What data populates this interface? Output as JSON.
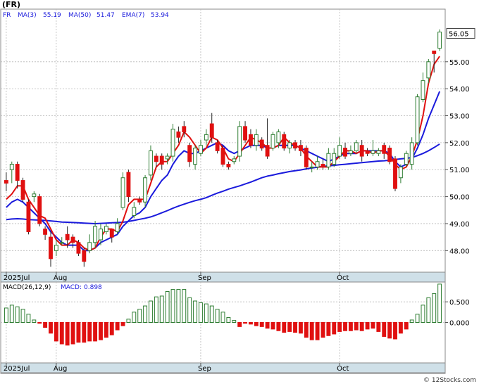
{
  "title": "(FR)",
  "footer": "© 12Stocks.com",
  "colors": {
    "up": "#2e7d32",
    "down": "#e01010",
    "ma_short": "#e01010",
    "ma_long": "#1a1adc",
    "ema": "#1a1adc",
    "grid": "#b8b8b8",
    "xband": "#cfe0e8",
    "hist_pos": "#2e7d32",
    "hist_neg": "#e01010"
  },
  "chart_data": [
    {
      "type": "candlestick",
      "legend": {
        "symbol": "FR",
        "items": [
          {
            "label": "MA(3)",
            "value": "55.19"
          },
          {
            "label": "MA(50)",
            "value": "51.47"
          },
          {
            "label": "EMA(7)",
            "value": "53.94"
          }
        ]
      },
      "ylim": [
        47.2,
        56.95
      ],
      "yticks": [
        {
          "v": 48.0,
          "label": "48.00"
        },
        {
          "v": 49.0,
          "label": "49.00"
        },
        {
          "v": 50.0,
          "label": "50.00"
        },
        {
          "v": 51.0,
          "label": "51.00"
        },
        {
          "v": 52.0,
          "label": "52.00"
        },
        {
          "v": 53.0,
          "label": "53.00"
        },
        {
          "v": 54.0,
          "label": "54.00"
        },
        {
          "v": 55.0,
          "label": "55.00"
        }
      ],
      "last_price": "56.05",
      "xticks": [
        {
          "i": 0,
          "label": "2025Jul"
        },
        {
          "i": 9,
          "label": "Aug"
        },
        {
          "i": 35,
          "label": "Sep"
        },
        {
          "i": 60,
          "label": "Oct"
        }
      ],
      "candles": [
        [
          50.6,
          50.5,
          50.9,
          50.2
        ],
        [
          51.0,
          51.2,
          51.3,
          50.5
        ],
        [
          51.2,
          50.6,
          51.3,
          50.3
        ],
        [
          50.6,
          49.9,
          50.7,
          49.8
        ],
        [
          49.8,
          48.7,
          49.9,
          48.6
        ],
        [
          50.0,
          50.1,
          50.2,
          49.8
        ],
        [
          50.0,
          49.0,
          50.1,
          48.9
        ],
        [
          48.8,
          48.6,
          48.9,
          48.4
        ],
        [
          48.5,
          47.7,
          48.7,
          47.4
        ],
        [
          48.0,
          48.2,
          48.4,
          47.8
        ],
        [
          48.3,
          48.3,
          48.5,
          48.2
        ],
        [
          48.6,
          48.4,
          48.9,
          48.1
        ],
        [
          48.5,
          48.3,
          48.6,
          48.1
        ],
        [
          48.3,
          47.9,
          48.4,
          47.8
        ],
        [
          48.0,
          47.6,
          48.1,
          47.4
        ],
        [
          48.0,
          48.3,
          48.6,
          47.9
        ],
        [
          48.3,
          48.9,
          49.1,
          48.1
        ],
        [
          48.4,
          48.8,
          49.0,
          48.2
        ],
        [
          48.7,
          48.9,
          49.0,
          48.6
        ],
        [
          48.8,
          48.5,
          48.8,
          48.3
        ],
        [
          48.7,
          49.0,
          49.2,
          48.6
        ],
        [
          49.6,
          50.7,
          50.9,
          49.5
        ],
        [
          50.9,
          50.0,
          51.0,
          49.8
        ],
        [
          49.3,
          49.6,
          49.8,
          49.2
        ],
        [
          49.9,
          49.8,
          50.0,
          49.7
        ],
        [
          49.8,
          50.7,
          50.8,
          49.6
        ],
        [
          50.8,
          51.7,
          51.9,
          50.6
        ],
        [
          51.5,
          51.3,
          51.6,
          51.1
        ],
        [
          51.5,
          51.2,
          51.6,
          51.0
        ],
        [
          51.4,
          51.5,
          51.6,
          51.2
        ],
        [
          51.5,
          52.5,
          52.7,
          51.3
        ],
        [
          52.4,
          52.2,
          52.6,
          52.0
        ],
        [
          52.6,
          52.4,
          52.8,
          52.2
        ],
        [
          51.9,
          51.3,
          52.0,
          51.1
        ],
        [
          51.2,
          51.8,
          51.9,
          51.0
        ],
        [
          51.6,
          51.9,
          52.1,
          51.5
        ],
        [
          52.1,
          52.3,
          52.5,
          51.9
        ],
        [
          52.7,
          52.2,
          53.1,
          52.0
        ],
        [
          52.0,
          51.7,
          52.1,
          51.6
        ],
        [
          51.8,
          51.2,
          51.9,
          51.1
        ],
        [
          51.2,
          51.1,
          51.3,
          51.0
        ],
        [
          51.3,
          51.4,
          51.5,
          51.2
        ],
        [
          51.5,
          52.6,
          52.8,
          51.3
        ],
        [
          52.6,
          52.1,
          52.8,
          52.0
        ],
        [
          52.3,
          51.9,
          52.5,
          51.8
        ],
        [
          51.9,
          52.3,
          52.5,
          51.7
        ],
        [
          52.1,
          51.8,
          52.2,
          51.7
        ],
        [
          51.9,
          51.5,
          52.9,
          51.4
        ],
        [
          51.8,
          52.3,
          52.4,
          51.7
        ],
        [
          52.0,
          52.4,
          52.5,
          51.8
        ],
        [
          52.3,
          51.8,
          52.4,
          51.7
        ],
        [
          51.8,
          52.0,
          52.1,
          51.6
        ],
        [
          52.0,
          51.8,
          52.1,
          51.7
        ],
        [
          51.9,
          51.7,
          52.1,
          51.5
        ],
        [
          51.8,
          51.1,
          51.9,
          51.0
        ],
        [
          51.1,
          51.1,
          51.3,
          50.9
        ],
        [
          51.1,
          51.3,
          51.5,
          51.0
        ],
        [
          51.2,
          51.1,
          51.4,
          51.0
        ],
        [
          51.1,
          51.6,
          51.8,
          51.0
        ],
        [
          51.2,
          51.6,
          51.8,
          51.1
        ],
        [
          51.5,
          51.9,
          52.2,
          51.4
        ],
        [
          51.8,
          51.5,
          52.0,
          51.4
        ],
        [
          51.6,
          51.7,
          51.9,
          51.5
        ],
        [
          51.7,
          52.0,
          52.1,
          51.6
        ],
        [
          51.9,
          51.5,
          52.1,
          51.3
        ],
        [
          51.7,
          51.6,
          51.8,
          51.5
        ],
        [
          51.6,
          51.7,
          52.1,
          51.5
        ],
        [
          51.6,
          51.7,
          51.8,
          51.5
        ],
        [
          51.9,
          51.6,
          52.0,
          51.4
        ],
        [
          51.8,
          51.3,
          51.9,
          51.2
        ],
        [
          51.4,
          50.3,
          51.5,
          50.2
        ],
        [
          50.7,
          51.1,
          51.2,
          50.5
        ],
        [
          51.2,
          51.6,
          51.7,
          51.1
        ],
        [
          51.2,
          52.0,
          52.2,
          51.0
        ],
        [
          52.0,
          53.7,
          53.8,
          51.9
        ],
        [
          53.6,
          54.3,
          54.6,
          53.5
        ],
        [
          54.4,
          55.0,
          55.1,
          54.2
        ],
        [
          55.4,
          55.3,
          55.3,
          54.6
        ],
        [
          55.5,
          56.1,
          56.2,
          55.4
        ]
      ],
      "ma3": [
        49.9,
        50.1,
        50.4,
        50.4,
        49.9,
        49.6,
        49.3,
        49.2,
        48.8,
        48.4,
        48.2,
        48.2,
        48.4,
        48.3,
        48.1,
        48.0,
        48.1,
        48.5,
        48.8,
        48.8,
        48.7,
        49.1,
        49.7,
        49.9,
        49.9,
        49.9,
        50.5,
        51.1,
        51.3,
        51.3,
        51.6,
        51.9,
        52.4,
        52.2,
        51.9,
        51.6,
        51.8,
        52.2,
        52.1,
        51.8,
        51.4,
        51.3,
        51.6,
        51.9,
        52.2,
        52.1,
        52.0,
        51.8,
        51.8,
        51.9,
        52.2,
        52.0,
        51.9,
        51.8,
        51.5,
        51.3,
        51.1,
        51.1,
        51.1,
        51.3,
        51.5,
        51.7,
        51.7,
        51.6,
        51.7,
        51.7,
        51.6,
        51.7,
        51.7,
        51.5,
        51.2,
        51.0,
        51.1,
        51.5,
        52.1,
        53.0,
        54.2,
        54.9,
        55.2
      ],
      "ema7": [
        49.6,
        49.8,
        49.9,
        49.8,
        49.6,
        49.4,
        49.2,
        49.0,
        48.7,
        48.5,
        48.3,
        48.2,
        48.2,
        48.2,
        48.0,
        48.0,
        48.1,
        48.3,
        48.4,
        48.5,
        48.6,
        48.9,
        49.1,
        49.3,
        49.4,
        49.6,
        50.0,
        50.3,
        50.6,
        50.8,
        51.2,
        51.5,
        51.7,
        51.6,
        51.6,
        51.7,
        51.8,
        51.9,
        52.0,
        51.9,
        51.7,
        51.6,
        51.7,
        51.8,
        51.9,
        51.9,
        51.9,
        51.8,
        51.8,
        51.9,
        51.9,
        51.9,
        51.9,
        51.8,
        51.7,
        51.6,
        51.5,
        51.4,
        51.3,
        51.4,
        51.5,
        51.6,
        51.6,
        51.6,
        51.7,
        51.7,
        51.7,
        51.7,
        51.7,
        51.6,
        51.3,
        51.1,
        51.2,
        51.4,
        51.8,
        52.3,
        52.9,
        53.4,
        53.9
      ],
      "ma50": [
        49.15,
        49.17,
        49.18,
        49.17,
        49.15,
        49.14,
        49.13,
        49.12,
        49.1,
        49.08,
        49.06,
        49.05,
        49.04,
        49.03,
        49.02,
        49.01,
        49.0,
        49.01,
        49.02,
        49.03,
        49.04,
        49.05,
        49.08,
        49.12,
        49.16,
        49.2,
        49.25,
        49.32,
        49.4,
        49.48,
        49.57,
        49.65,
        49.72,
        49.79,
        49.85,
        49.9,
        49.96,
        50.05,
        50.13,
        50.2,
        50.28,
        50.34,
        50.4,
        50.47,
        50.54,
        50.62,
        50.7,
        50.76,
        50.8,
        50.85,
        50.89,
        50.93,
        50.96,
        50.99,
        51.03,
        51.06,
        51.09,
        51.12,
        51.14,
        51.16,
        51.18,
        51.2,
        51.22,
        51.24,
        51.26,
        51.28,
        51.3,
        51.32,
        51.33,
        51.35,
        51.38,
        51.4,
        51.42,
        51.45,
        51.52,
        51.6,
        51.7,
        51.82,
        51.95
      ]
    },
    {
      "type": "bar",
      "legend": {
        "items": [
          {
            "label": "MACD(26,12,9)",
            "value": ""
          },
          {
            "label": "MACD:",
            "value": "0.898"
          }
        ]
      },
      "ylim": [
        -0.98,
        0.98
      ],
      "yticks": [
        {
          "v": 0.5,
          "label": "0.500"
        },
        {
          "v": 0.0,
          "label": "0.000"
        }
      ],
      "xticks": [
        {
          "i": 0,
          "label": "2025Jul"
        },
        {
          "i": 9,
          "label": "Aug"
        },
        {
          "i": 35,
          "label": "Sep"
        },
        {
          "i": 60,
          "label": "Oct"
        }
      ],
      "values": [
        0.35,
        0.42,
        0.38,
        0.32,
        0.2,
        0.06,
        -0.02,
        -0.12,
        -0.26,
        -0.45,
        -0.52,
        -0.55,
        -0.52,
        -0.48,
        -0.48,
        -0.45,
        -0.45,
        -0.42,
        -0.36,
        -0.3,
        -0.18,
        -0.08,
        0.08,
        0.25,
        0.32,
        0.4,
        0.52,
        0.62,
        0.64,
        0.75,
        0.8,
        0.8,
        0.8,
        0.6,
        0.52,
        0.48,
        0.45,
        0.4,
        0.32,
        0.25,
        0.12,
        0.05,
        -0.1,
        -0.02,
        -0.04,
        -0.08,
        -0.1,
        -0.14,
        -0.16,
        -0.2,
        -0.24,
        -0.22,
        -0.24,
        -0.26,
        -0.36,
        -0.42,
        -0.42,
        -0.36,
        -0.32,
        -0.28,
        -0.22,
        -0.2,
        -0.2,
        -0.18,
        -0.2,
        -0.16,
        -0.14,
        -0.22,
        -0.34,
        -0.38,
        -0.4,
        -0.26,
        -0.16,
        0.06,
        0.2,
        0.42,
        0.6,
        0.7,
        0.93
      ]
    }
  ]
}
